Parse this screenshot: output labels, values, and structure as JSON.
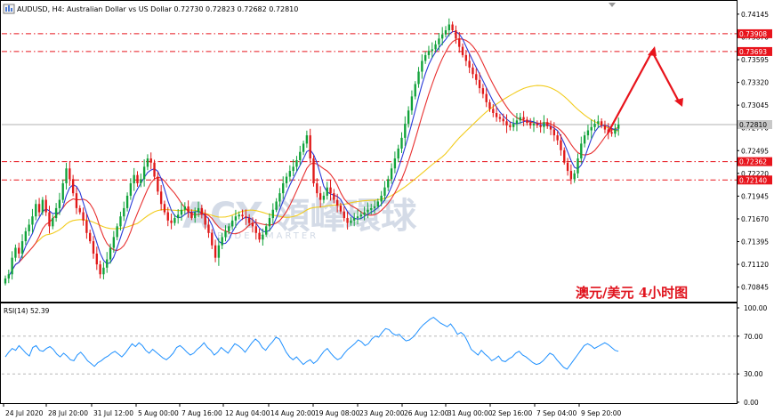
{
  "chart_data": [
    {
      "type": "candlestick",
      "symbol_label": "AUDUSD, H4:  Australian Dollar vs US Dollar  0.72730 0.72823 0.72682 0.72810",
      "annotation": "澳元/美元     4小时图",
      "watermark": "ACY 領峰環球",
      "watermark_sub": "TRADE SMARTER",
      "y_ticks": [
        "0.74145",
        "0.73870",
        "0.73595",
        "0.73320",
        "0.73045",
        "0.72770",
        "0.72495",
        "0.72220",
        "0.71945",
        "0.71670",
        "0.71395",
        "0.71120",
        "0.70845"
      ],
      "ylim": [
        0.7068,
        0.7423
      ],
      "x_labels": [
        "24 Jul 2020",
        "28 Jul 20:00",
        "31 Jul 12:00",
        "5 Aug 00:00",
        "7 Aug 16:00",
        "12 Aug 04:00",
        "14 Aug 20:00",
        "19 Aug 08:00",
        "23 Aug 20:00",
        "26 Aug 12:00",
        "31 Aug 00:00",
        "2 Sep 16:00",
        "7 Sep 04:00",
        "9 Sep 20:00"
      ],
      "price_levels": [
        {
          "label": "0.73908",
          "value": 0.73908
        },
        {
          "label": "0.73693",
          "value": 0.73693
        },
        {
          "label": "0.72362",
          "value": 0.72362
        },
        {
          "label": "0.72140",
          "value": 0.7214
        }
      ],
      "current_price": {
        "label": "0.72810",
        "value": 0.7281
      },
      "close_series": [
        0.7095,
        0.71,
        0.712,
        0.7132,
        0.7125,
        0.714,
        0.7152,
        0.716,
        0.717,
        0.7185,
        0.7175,
        0.719,
        0.7175,
        0.7158,
        0.7168,
        0.718,
        0.719,
        0.721,
        0.7228,
        0.7215,
        0.7198,
        0.718,
        0.7175,
        0.7165,
        0.715,
        0.714,
        0.7125,
        0.7112,
        0.71,
        0.7108,
        0.7118,
        0.7132,
        0.7145,
        0.7158,
        0.717,
        0.718,
        0.7195,
        0.721,
        0.722,
        0.721,
        0.7215,
        0.723,
        0.724,
        0.7235,
        0.7218,
        0.72,
        0.7185,
        0.7175,
        0.7165,
        0.7162,
        0.7168,
        0.7172,
        0.7178,
        0.7182,
        0.7175,
        0.7168,
        0.7175,
        0.718,
        0.7172,
        0.716,
        0.715,
        0.7135,
        0.712,
        0.7135,
        0.7145,
        0.7152,
        0.7158,
        0.7165,
        0.717,
        0.7172,
        0.717,
        0.7168,
        0.7162,
        0.7158,
        0.715,
        0.7142,
        0.7148,
        0.7158,
        0.7168,
        0.7178,
        0.7188,
        0.7198,
        0.721,
        0.7218,
        0.7225,
        0.723,
        0.7238,
        0.7248,
        0.7258,
        0.7268,
        0.724,
        0.721,
        0.7198,
        0.719,
        0.7195,
        0.7205,
        0.7198,
        0.719,
        0.7183,
        0.7176,
        0.7168,
        0.7162,
        0.7165,
        0.7168,
        0.717,
        0.7172,
        0.7175,
        0.7178,
        0.718,
        0.7182,
        0.7188,
        0.7195,
        0.7205,
        0.7215,
        0.7228,
        0.724,
        0.7252,
        0.7265,
        0.7282,
        0.7298,
        0.7315,
        0.733,
        0.7345,
        0.7358,
        0.7365,
        0.737,
        0.7372,
        0.7378,
        0.7385,
        0.739,
        0.7395,
        0.7402,
        0.7395,
        0.7385,
        0.7375,
        0.7365,
        0.7358,
        0.735,
        0.7342,
        0.7335,
        0.7325,
        0.7318,
        0.7308,
        0.73,
        0.7295,
        0.729,
        0.7288,
        0.7285,
        0.728,
        0.7278,
        0.7282,
        0.7286,
        0.729,
        0.7287,
        0.7283,
        0.728,
        0.7282,
        0.728,
        0.7278,
        0.7284,
        0.7279,
        0.7275,
        0.7268,
        0.7262,
        0.725,
        0.7235,
        0.7225,
        0.7215,
        0.7222,
        0.724,
        0.7258,
        0.7268,
        0.7274,
        0.7278,
        0.7282,
        0.7285,
        0.728,
        0.7275,
        0.7272,
        0.727,
        0.7276,
        0.7281
      ],
      "rsi": {
        "label": "RSI(14) 52.39",
        "y_ticks": [
          "100.00",
          "70.00",
          "30.00",
          "0.00"
        ],
        "ylim": [
          0,
          100
        ],
        "levels": [
          70,
          30
        ],
        "values": [
          48,
          53,
          57,
          55,
          60,
          56,
          52,
          49,
          58,
          60,
          55,
          54,
          57,
          59,
          56,
          51,
          48,
          52,
          49,
          45,
          44,
          50,
          53,
          49,
          44,
          41,
          38,
          42,
          44,
          47,
          49,
          52,
          54,
          51,
          48,
          52,
          57,
          62,
          59,
          63,
          60,
          55,
          52,
          56,
          53,
          50,
          47,
          45,
          48,
          52,
          58,
          60,
          57,
          53,
          50,
          52,
          56,
          59,
          63,
          58,
          55,
          50,
          53,
          58,
          55,
          52,
          57,
          62,
          60,
          57,
          53,
          58,
          63,
          67,
          64,
          58,
          55,
          60,
          64,
          69,
          67,
          60,
          53,
          48,
          45,
          48,
          44,
          40,
          43,
          45,
          41,
          44,
          49,
          54,
          57,
          52,
          48,
          45,
          47,
          52,
          56,
          59,
          62,
          66,
          64,
          60,
          62,
          67,
          70,
          69,
          74,
          78,
          77,
          73,
          71,
          72,
          68,
          65,
          66,
          69,
          73,
          78,
          82,
          85,
          88,
          90,
          87,
          84,
          82,
          80,
          83,
          78,
          72,
          74,
          71,
          64,
          56,
          53,
          50,
          55,
          51,
          48,
          44,
          46,
          49,
          44,
          43,
          46,
          48,
          52,
          54,
          50,
          48,
          45,
          42,
          40,
          41,
          44,
          48,
          52,
          50,
          45,
          41,
          37,
          35,
          40,
          45,
          50,
          55,
          60,
          62,
          60,
          57,
          59,
          61,
          63,
          61,
          58,
          55,
          54
        ]
      }
    }
  ]
}
